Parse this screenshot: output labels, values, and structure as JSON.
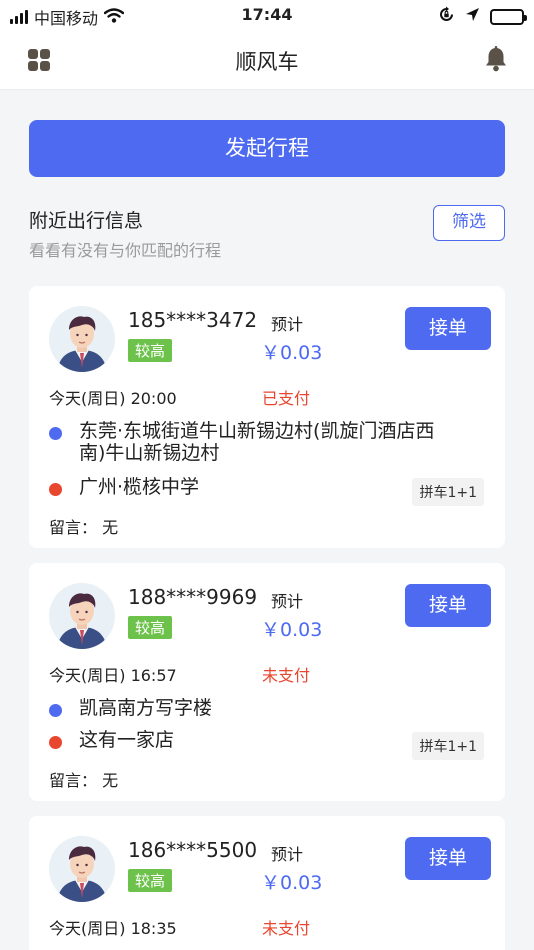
{
  "status_bar": {
    "carrier": "中国移动",
    "time": "17:44"
  },
  "nav": {
    "title": "顺风车"
  },
  "actions": {
    "start_trip": "发起行程",
    "filter": "筛选"
  },
  "section": {
    "title": "附近出行信息",
    "subtitle": "看看有没有与你匹配的行程"
  },
  "trips": [
    {
      "phone": "185****3472",
      "level": "较高",
      "estimate_label": "预计",
      "price": "￥0.03",
      "accept": "接单",
      "datetime": "今天(周日) 20:00",
      "pay_status": "已支付",
      "from": "东莞·东城街道牛山新锡边村(凯旋门酒店西南)牛山新锡边村",
      "to": "广州·榄核中学",
      "pool": "拼车1+1",
      "message": "留言：  无"
    },
    {
      "phone": "188****9969",
      "level": "较高",
      "estimate_label": "预计",
      "price": "￥0.03",
      "accept": "接单",
      "datetime": "今天(周日) 16:57",
      "pay_status": "未支付",
      "from": "凯高南方写字楼",
      "to": "这有一家店",
      "pool": "拼车1+1",
      "message": "留言：  无"
    },
    {
      "phone": "186****5500",
      "level": "较高",
      "estimate_label": "预计",
      "price": "￥0.03",
      "accept": "接单",
      "datetime": "今天(周日) 18:35",
      "pay_status": "未支付"
    }
  ],
  "colors": {
    "primary": "#4d6af0",
    "badge_green": "#6cc24a",
    "status_red": "#e8462f"
  },
  "icons": [
    "cellular-signal-icon",
    "wifi-icon",
    "rotation-lock-icon",
    "location-arrow-icon",
    "battery-icon",
    "grid-menu-icon",
    "bell-icon",
    "avatar-icon"
  ]
}
